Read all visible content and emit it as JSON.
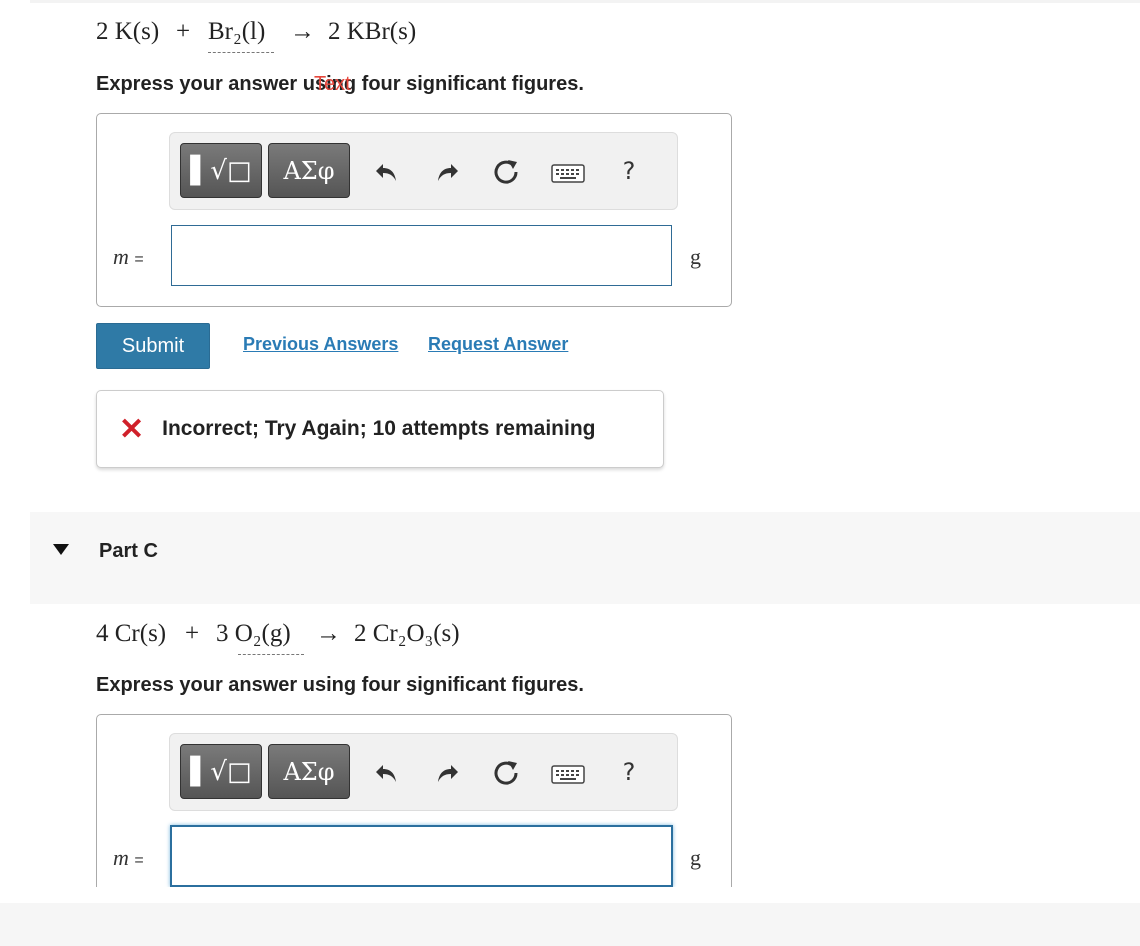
{
  "partB": {
    "equation": {
      "lhs1": "2 K(s)",
      "plus": "+",
      "lhs2": "Br₂(l)",
      "arrow": "→",
      "rhs": "2 KBr(s)"
    },
    "instruction": "Express your answer using four significant figures.",
    "instruction_overlay": "Text",
    "toolbar": {
      "template_label": "▌√□",
      "greek_label": "ΑΣφ",
      "help_label": "?"
    },
    "field_label": "m",
    "field_eq": "=",
    "input_value": "",
    "unit": "g",
    "submit_label": "Submit",
    "previous_answers_label": "Previous Answers",
    "request_answer_label": "Request Answer",
    "feedback_message": "Incorrect; Try Again; 10 attempts remaining"
  },
  "partC": {
    "title": "Part C",
    "equation": {
      "lhs1": "4 Cr(s)",
      "plus": "+",
      "lhs2": "3 O₂(g)",
      "arrow": "→",
      "rhs": "2 Cr₂O₃(s)"
    },
    "instruction": "Express your answer using four significant figures.",
    "toolbar": {
      "template_label": "▌√□",
      "greek_label": "ΑΣφ",
      "help_label": "?"
    },
    "field_label": "m",
    "field_eq": "=",
    "input_value": "",
    "unit": "g"
  },
  "colors": {
    "submit": "#2f7aa6",
    "link": "#2a7bb5",
    "error": "#d0202a",
    "overlay": "#e5473c"
  },
  "icons": {
    "undo": "undo-icon",
    "redo": "redo-icon",
    "reset": "reset-icon",
    "keyboard": "keyboard-icon",
    "collapse": "triangle-down-icon",
    "feedback": "x-icon"
  }
}
